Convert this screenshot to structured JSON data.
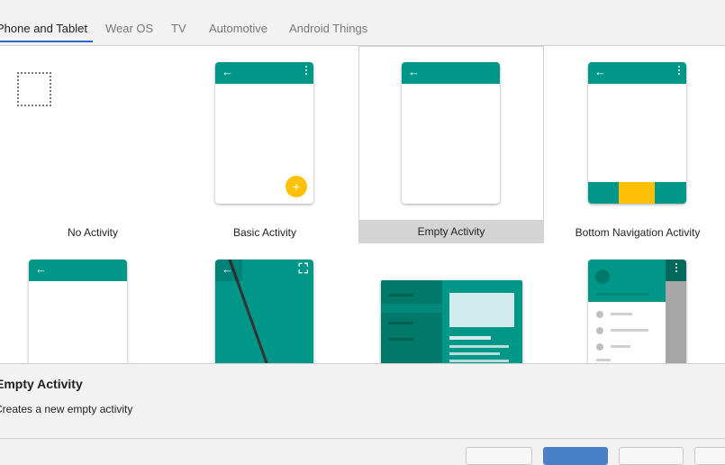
{
  "tabs": [
    {
      "label": "Phone and Tablet"
    },
    {
      "label": "Wear OS"
    },
    {
      "label": "TV"
    },
    {
      "label": "Automotive"
    },
    {
      "label": "Android Things"
    }
  ],
  "templates": [
    {
      "label": "No Activity"
    },
    {
      "label": "Basic Activity"
    },
    {
      "label": "Empty Activity"
    },
    {
      "label": "Bottom Navigation Activity"
    }
  ],
  "details": {
    "title": "Empty Activity",
    "description": "Creates a new empty activity"
  },
  "icons": {
    "arrow": "←",
    "plus": "+",
    "fullscreen": "⛶"
  },
  "colors": {
    "primary": "#009688",
    "accent": "#ffc107",
    "tab_underline": "#2f65ca"
  }
}
